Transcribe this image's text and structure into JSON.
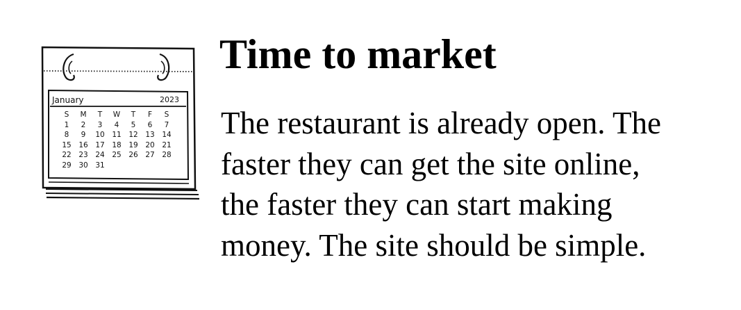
{
  "calendar": {
    "month": "January",
    "year": "2023",
    "weekdays": [
      "S",
      "M",
      "T",
      "W",
      "T",
      "F",
      "S"
    ],
    "days": [
      "1",
      "2",
      "3",
      "4",
      "5",
      "6",
      "7",
      "8",
      "9",
      "10",
      "11",
      "12",
      "13",
      "14",
      "15",
      "16",
      "17",
      "18",
      "19",
      "20",
      "21",
      "22",
      "23",
      "24",
      "25",
      "26",
      "27",
      "28",
      "29",
      "30",
      "31"
    ]
  },
  "heading": "Time to market",
  "body": {
    "lines": [
      "The restaurant is already open. The",
      "faster they can get the site online,",
      "the faster they can start making",
      "money. The site should be simple."
    ]
  }
}
